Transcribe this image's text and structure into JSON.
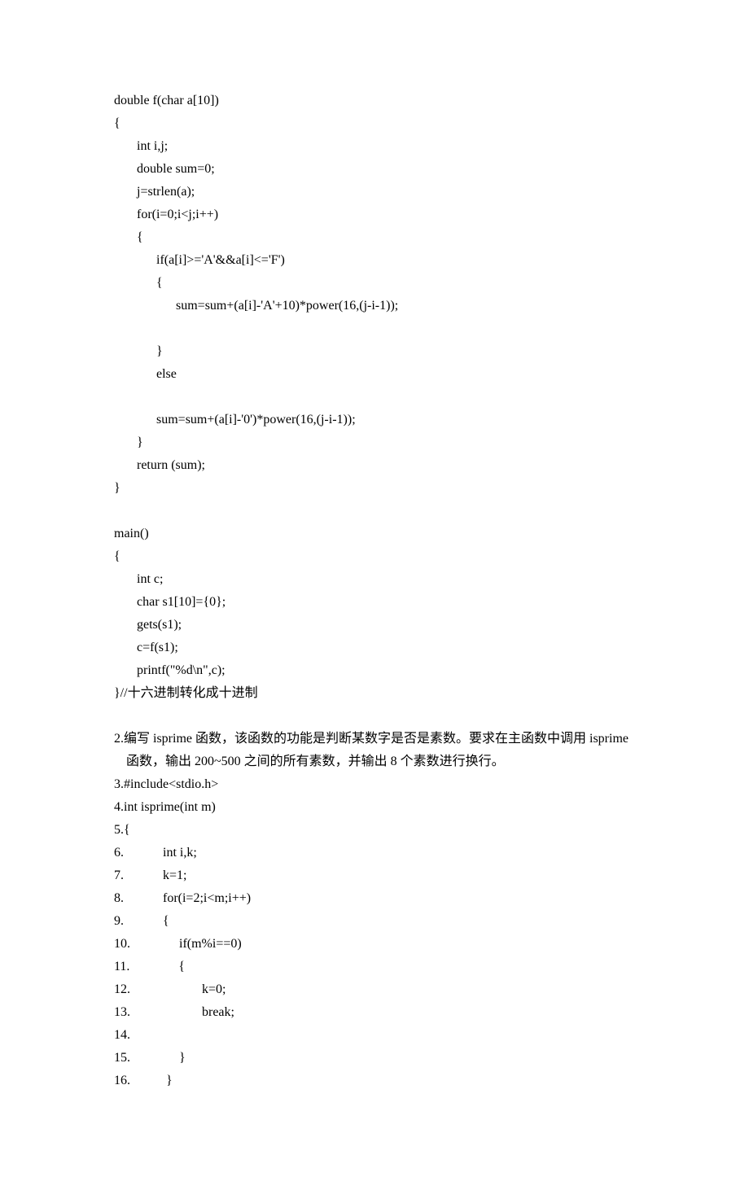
{
  "code_block_1": [
    "double f(char a[10])",
    "{",
    "       int i,j;",
    "       double sum=0;",
    "       j=strlen(a);",
    "       for(i=0;i<j;i++)",
    "       {",
    "             if(a[i]>='A'&&a[i]<='F')",
    "             {",
    "                   sum=sum+(a[i]-'A'+10)*power(16,(j-i-1));",
    "",
    "             }",
    "             else",
    "",
    "             sum=sum+(a[i]-'0')*power(16,(j-i-1));",
    "       }",
    "       return (sum);",
    "}",
    "",
    "main()",
    "{",
    "       int c;",
    "       char s1[10]={0};",
    "       gets(s1);",
    "       c=f(s1);",
    "       printf(\"%d\\n\",c);",
    "}//十六进制转化成十进制"
  ],
  "problem2": {
    "line1": "2.编写 isprime 函数，该函数的功能是判断某数字是否是素数。要求在主函数中调用 isprime",
    "line2": "函数，输出 200~500 之间的所有素数，并输出 8 个素数进行换行。"
  },
  "code_block_2": [
    "3.#include<stdio.h>",
    "4.int isprime(int m)",
    "5.{",
    "6.            int i,k;",
    "7.            k=1;",
    "8.            for(i=2;i<m;i++)",
    "9.            {",
    "10.               if(m%i==0)",
    "11.               {",
    "12.                      k=0;",
    "13.                      break;",
    "14.",
    "15.               }",
    "16.           }"
  ]
}
